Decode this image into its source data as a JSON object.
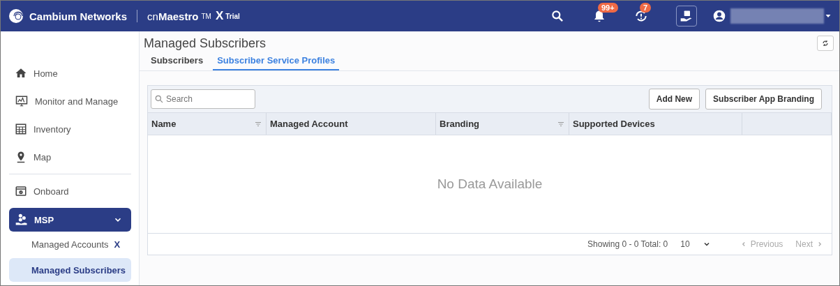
{
  "header": {
    "brand": "Cambium Networks",
    "product_prefix": "cn",
    "product": "Maestro",
    "trademark": "TM",
    "edition": "X",
    "edition_tag": "Trial",
    "alerts": [
      {
        "kind": "bell",
        "badge": "99+"
      },
      {
        "kind": "alarm",
        "badge": "7"
      }
    ]
  },
  "sidebar": {
    "sections": [
      [
        {
          "kind": "home",
          "label": "Home",
          "selected": false
        },
        {
          "kind": "monitor",
          "label": "Monitor and Manage",
          "selected": false
        },
        {
          "kind": "inventory",
          "label": "Inventory",
          "selected": false
        },
        {
          "kind": "map",
          "label": "Map",
          "selected": false
        }
      ],
      [
        {
          "kind": "onboard",
          "label": "Onboard",
          "selected": false
        },
        {
          "kind": "msp",
          "label": "MSP",
          "selected": true,
          "expanded": true,
          "children": [
            {
              "label": "Managed Accounts",
              "mark": "X",
              "selected": false
            },
            {
              "label": "Managed Subscribers",
              "selected": true
            }
          ]
        }
      ]
    ]
  },
  "page": {
    "title": "Managed Subscribers",
    "tabs": [
      {
        "label": "Subscribers",
        "selected": false
      },
      {
        "label": "Subscriber Service Profiles",
        "selected": true
      }
    ],
    "search": {
      "placeholder": "Search"
    },
    "buttons": [
      "Add New",
      "Subscriber App Branding"
    ],
    "table": {
      "columns": [
        {
          "label": "Name",
          "filter": true
        },
        {
          "label": "Managed Account",
          "filter": false
        },
        {
          "label": "Branding",
          "filter": true
        },
        {
          "label": "Supported Devices",
          "filter": false
        }
      ],
      "empty_message": "No Data Available"
    },
    "pagination": {
      "summary": "Showing 0 - 0 Total: 0",
      "page_size": "10",
      "previous": {
        "label": "Previous",
        "disabled": true
      },
      "next": {
        "label": "Next",
        "disabled": true
      }
    }
  }
}
